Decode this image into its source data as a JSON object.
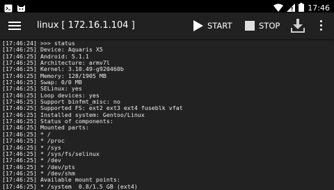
{
  "status_bar": {
    "time": "17:46",
    "icons": [
      "terminal-icon",
      "cat-icon",
      "wifi-icon",
      "no-sim-icon",
      "battery-icon"
    ]
  },
  "app_bar": {
    "title": "linux [ 172.16.1.104 ]",
    "start_label": "START",
    "stop_label": "STOP",
    "icons": [
      "menu-icon",
      "play-icon",
      "stop-icon",
      "download-icon",
      "more-vert-icon"
    ]
  },
  "console": {
    "lines": [
      "[17:46:24] >>> status",
      "[17:46:25] Device: Aquaris X5",
      "[17:46:25] Android: 5.1.1",
      "[17:46:25] Architecture: armv7l",
      "[17:46:25] Kernel: 3.10.49-g920460b",
      "[17:46:25] Memory: 128/1905 MB",
      "[17:46:25] Swap: 0/0 MB",
      "[17:46:25] SELinux: yes",
      "[17:46:25] Loop devices: yes",
      "[17:46:25] Support binfmt_misc: no",
      "[17:46:25] Supported FS: ext2 ext3 ext4 fuseblk vfat",
      "[17:46:25] Installed system: Gentoo/Linux",
      "[17:46:25] Status of components:",
      "[17:46:25] Mounted parts:",
      "[17:46:25] * /",
      "[17:46:25] * /proc",
      "[17:46:25] * /sys",
      "[17:46:25] * /sys/fs/selinux",
      "[17:46:25] * /dev",
      "[17:46:25] * /dev/pts",
      "[17:46:25] * /dev/shm",
      "[17:46:25] Available mount points:",
      "[17:46:25] * /system  0.8/1.5 GB (ext4)"
    ]
  }
}
